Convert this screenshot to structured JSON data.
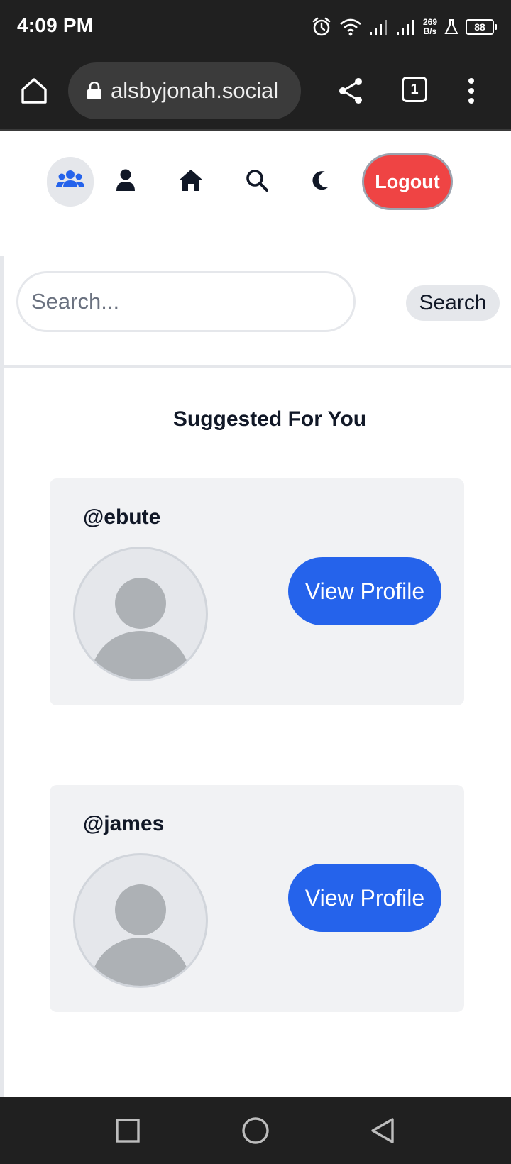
{
  "status_bar": {
    "time": "4:09 PM",
    "net_speed_value": "269",
    "net_speed_unit": "B/s",
    "battery": "88",
    "icons": [
      "alarm-icon",
      "wifi-icon",
      "signal-icon",
      "signal-icon",
      "flask-icon",
      "battery-icon"
    ]
  },
  "browser": {
    "url": "alsbyjonah.social",
    "tab_count": "1",
    "icons": [
      "home-icon",
      "lock-icon",
      "share-icon",
      "tabs-icon",
      "more-vert-icon"
    ]
  },
  "nav": {
    "items": [
      {
        "icon": "users-icon",
        "active": true
      },
      {
        "icon": "user-icon",
        "active": false
      },
      {
        "icon": "home-icon",
        "active": false
      },
      {
        "icon": "search-icon",
        "active": false
      },
      {
        "icon": "moon-icon",
        "active": false
      }
    ],
    "logout_label": "Logout"
  },
  "search": {
    "placeholder": "Search...",
    "value": "",
    "button_label": "Search"
  },
  "suggestions": {
    "title": "Suggested For You",
    "users": [
      {
        "username": "@ebute",
        "button_label": "View Profile"
      },
      {
        "username": "@james",
        "button_label": "View Profile"
      }
    ]
  },
  "android_nav": {
    "icons": [
      "recents-icon",
      "home-circle-icon",
      "back-icon"
    ]
  },
  "colors": {
    "accent": "#2563eb",
    "logout": "#ef4444",
    "card_bg": "#f1f2f4",
    "system_bar": "#202020"
  }
}
